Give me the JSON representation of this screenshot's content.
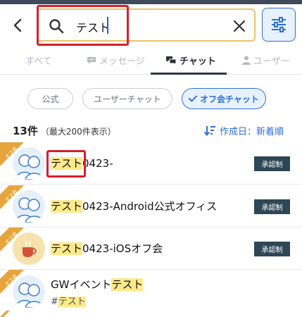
{
  "search": {
    "value": "テスト"
  },
  "tabs": [
    {
      "label": "すべて"
    },
    {
      "label": "メッセージ"
    },
    {
      "label": "チャット"
    },
    {
      "label": "ユーザー"
    }
  ],
  "chips": [
    {
      "label": "公式"
    },
    {
      "label": "ユーザーチャット"
    },
    {
      "label": "オフ会チャット"
    }
  ],
  "results": {
    "count": "13件",
    "count_note": "（最大200件表示）",
    "sort_label": "作成日：新着順",
    "ribbon_text": "オフ会",
    "items": [
      {
        "title_highlight": "テスト",
        "title_rest": "0423-",
        "badge": "承認制"
      },
      {
        "title_highlight": "テスト",
        "title_rest": "0423-Android公式オフィス",
        "badge": "承認制"
      },
      {
        "title_highlight": "テスト",
        "title_rest": "0423-iOSオフ会",
        "badge": "承認制"
      },
      {
        "title_prefix": "GWイベント",
        "title_highlight": "テスト",
        "tag_prefix": "#",
        "tag_highlight": "テスト"
      }
    ]
  },
  "colors": {
    "accent": "#2c6fd6",
    "highlight": "#fde98a",
    "badge_bg": "#2d4756",
    "ribbon": "#e6a53c",
    "annotation": "#d61f2b"
  }
}
